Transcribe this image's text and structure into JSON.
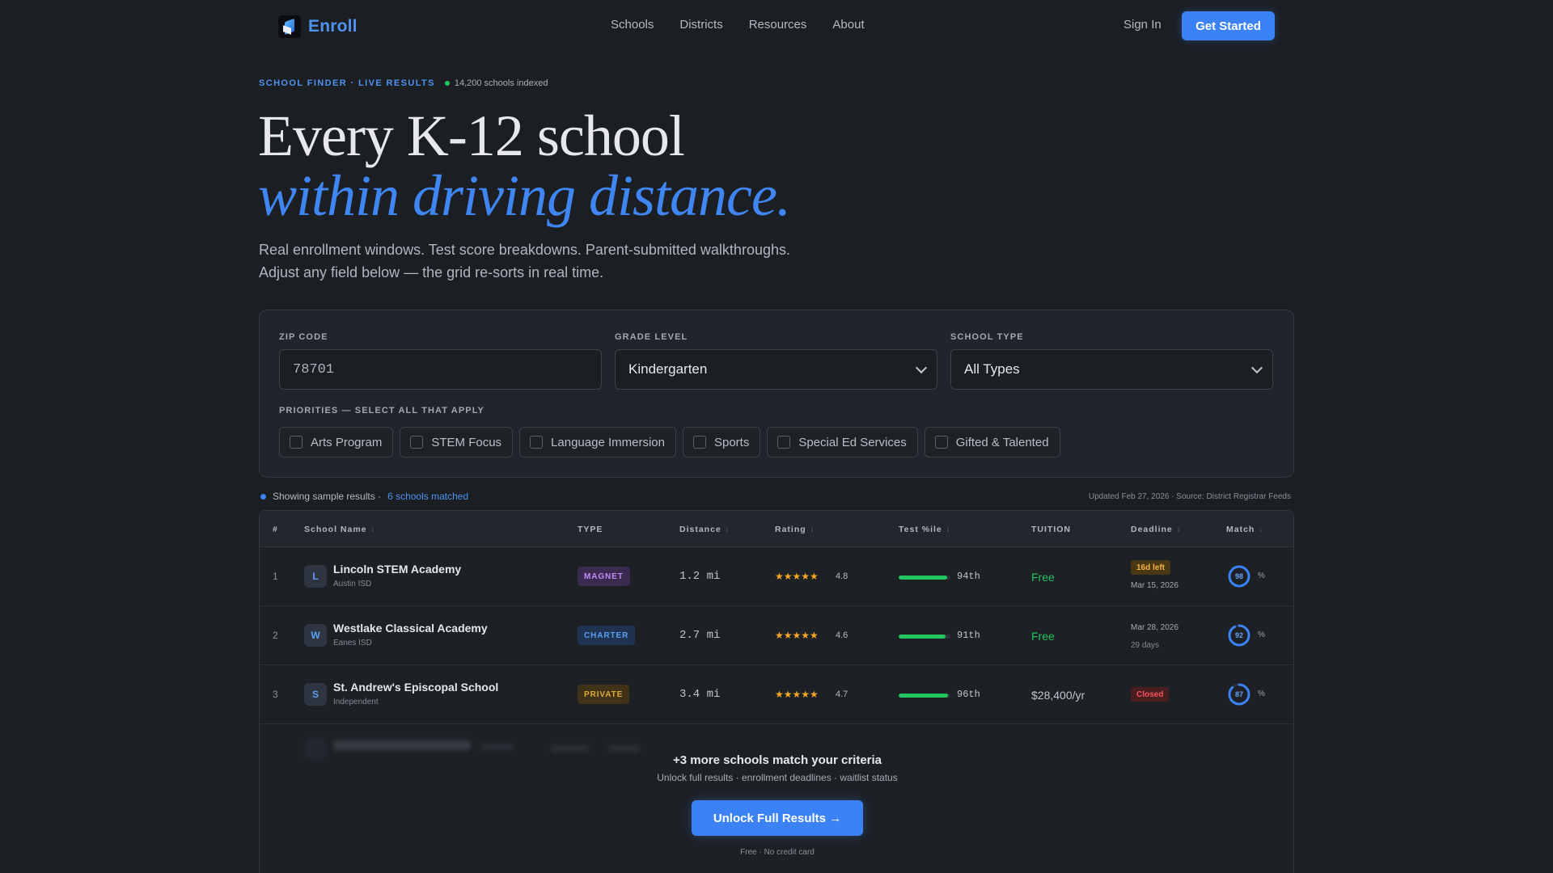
{
  "nav": {
    "brand": "Enroll",
    "links": [
      "Schools",
      "Districts",
      "Resources",
      "About"
    ],
    "sign_in": "Sign In",
    "cta": "Get Started"
  },
  "hero": {
    "eyebrow": "SCHOOL FINDER · LIVE RESULTS",
    "indexed": "14,200 schools indexed",
    "title_line1": "Every K-12 school",
    "title_line2": "within driving distance.",
    "subtitle_line1": "Real enrollment windows. Test score breakdowns. Parent-submitted walkthroughs.",
    "subtitle_line2": "Adjust any field below — the grid re-sorts in real time."
  },
  "filters": {
    "zip_label": "ZIP CODE",
    "zip_value": "78701",
    "grade_label": "GRADE LEVEL",
    "grade_value": "Kindergarten",
    "type_label": "SCHOOL TYPE",
    "type_value": "All Types",
    "priorities_label": "PRIORITIES — SELECT ALL THAT APPLY",
    "priorities": [
      "Arts Program",
      "STEM Focus",
      "Language Immersion",
      "Sports",
      "Special Ed Services",
      "Gifted & Talented"
    ]
  },
  "results_meta": {
    "showing": "Showing sample results ·",
    "matched": "6 schools matched",
    "updated": "Updated Feb 27, 2026 · Source: District Registrar Feeds"
  },
  "table": {
    "headers": {
      "num": "#",
      "name": "School Name",
      "type": "TYPE",
      "distance": "Distance",
      "rating": "Rating",
      "test": "Test %ile",
      "tuition": "TUITION",
      "deadline": "Deadline",
      "match": "Match"
    },
    "rows": [
      {
        "num": "1",
        "initial": "L",
        "name": "Lincoln STEM Academy",
        "district": "Austin ISD",
        "type": "MAGNET",
        "type_bg": "#3a2a4f",
        "type_fg": "#c08cf5",
        "distance": "1.2 mi",
        "stars": "★★★★★",
        "rating": "4.8",
        "test_pct": 94,
        "test_label": "94th",
        "tuition": "Free",
        "tuition_color": "#22c55e",
        "deadline_tag": "16d left",
        "deadline_tag_bg": "#4a3714",
        "deadline_tag_fg": "#f5b342",
        "deadline_date": "Mar 15, 2026",
        "deadline_sub": "",
        "match": "98",
        "match_pct": 98
      },
      {
        "num": "2",
        "initial": "W",
        "name": "Westlake Classical Academy",
        "district": "Eanes ISD",
        "type": "CHARTER",
        "type_bg": "#1f3350",
        "type_fg": "#5b9df2",
        "distance": "2.7 mi",
        "stars": "★★★★★",
        "rating": "4.6",
        "test_pct": 91,
        "test_label": "91th",
        "tuition": "Free",
        "tuition_color": "#22c55e",
        "deadline_tag": "",
        "deadline_date": "Mar 28, 2026",
        "deadline_sub": "29 days",
        "match": "92",
        "match_pct": 92
      },
      {
        "num": "3",
        "initial": "S",
        "name": "St. Andrew's Episcopal School",
        "district": "Independent",
        "type": "PRIVATE",
        "type_bg": "#3f3216",
        "type_fg": "#e0a93a",
        "distance": "3.4 mi",
        "stars": "★★★★★",
        "rating": "4.7",
        "test_pct": 96,
        "test_label": "96th",
        "tuition": "$28,400/yr",
        "tuition_color": "#c0c6ce",
        "deadline_tag": "Closed",
        "deadline_tag_bg": "#4a1d20",
        "deadline_tag_fg": "#f2555a",
        "deadline_date": "",
        "deadline_sub": "",
        "match": "87",
        "match_pct": 87
      }
    ],
    "pct_suffix": "%"
  },
  "unlock": {
    "title": "+3 more schools match your criteria",
    "subtitle": "Unlock full results · enrollment deadlines · waitlist status",
    "button": "Unlock Full Results →",
    "note": "Free · No credit card"
  },
  "colors": {
    "accent": "#3b82f6",
    "background": "#1b1e23",
    "panel": "#21252b",
    "success": "#22c55e",
    "star": "#f5a623"
  },
  "icons": [
    "logo-mark-icon",
    "chevron-down-icon",
    "checkbox-icon",
    "sort-icon",
    "star-icon",
    "status-dot-icon"
  ]
}
